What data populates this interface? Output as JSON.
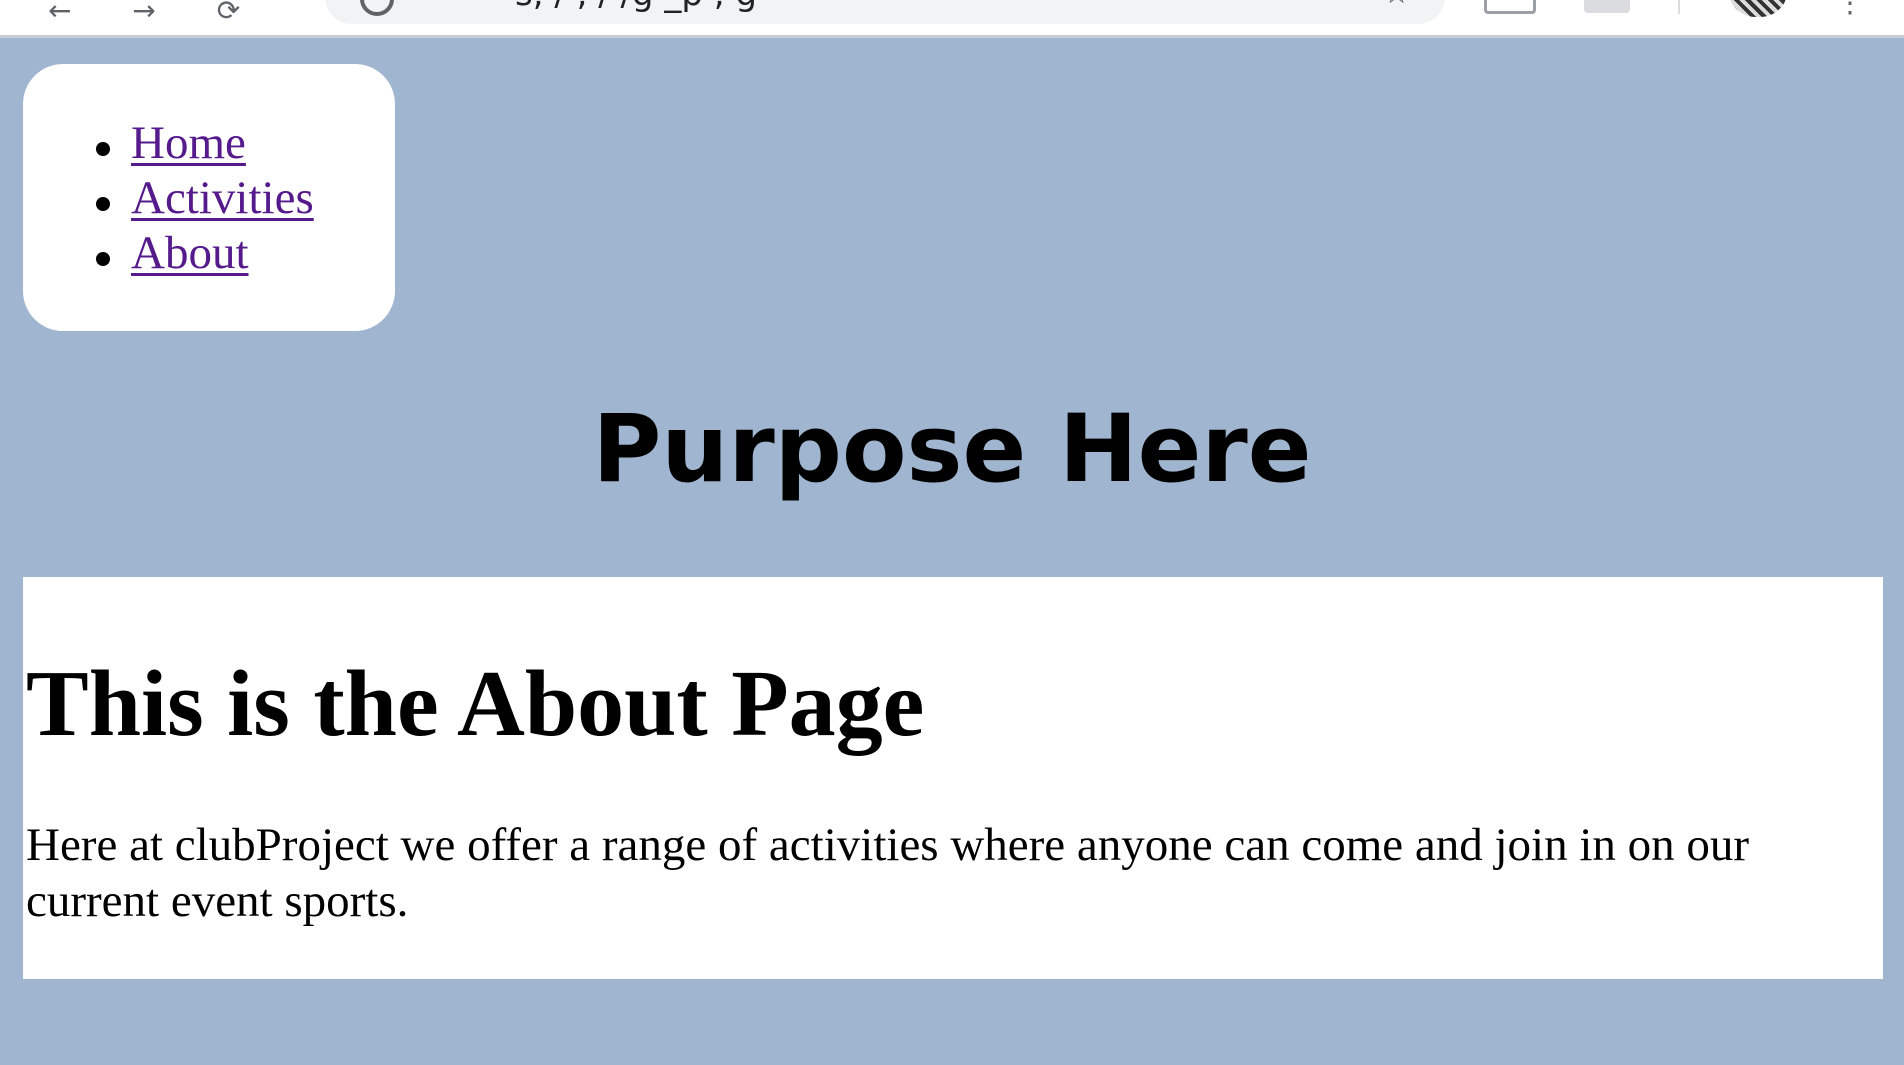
{
  "browser": {
    "nav_glyphs": [
      "←",
      "→",
      "⟳"
    ],
    "address": "s, / , /  /g  _p      ,  g",
    "star_glyph": "☆",
    "menu_glyph": "⋮"
  },
  "nav": {
    "items": [
      {
        "label": "Home"
      },
      {
        "label": "Activities"
      },
      {
        "label": "About"
      }
    ]
  },
  "banner": {
    "title": "Purpose Here"
  },
  "main": {
    "heading": "This is the About Page",
    "paragraph": "Here at clubProject we offer a range of activities where anyone can come and join in on our current event sports."
  },
  "colors": {
    "page_background": "#a0b5cf",
    "card_background": "#ffffff",
    "link_visited": "#551a8b"
  }
}
